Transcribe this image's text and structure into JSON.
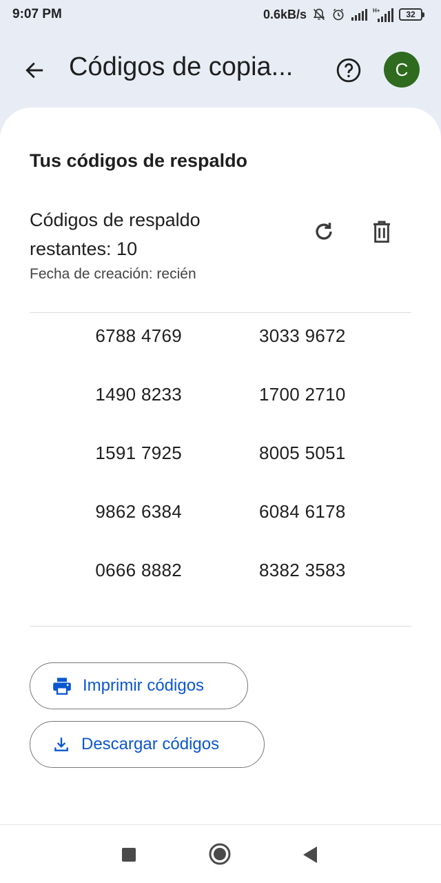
{
  "status_bar": {
    "time": "9:07 PM",
    "speed": "0.6kB/s",
    "icons": [
      "mute-icon",
      "alarm-icon",
      "signal-icon",
      "signal-icon-2"
    ],
    "battery": "32"
  },
  "app_bar": {
    "back_icon": "arrow-left-icon",
    "title": "Códigos de copia...",
    "help_icon": "help-circle-icon",
    "avatar_letter": "C",
    "avatar_color": "#2e6b1f"
  },
  "content": {
    "section_title": "Tus códigos de respaldo",
    "remaining_text": "Códigos de respaldo restantes: 10",
    "created_text": "Fecha de creación: recién",
    "codes": [
      [
        "6788 4769",
        "3033 9672"
      ],
      [
        "1490 8233",
        "1700 2710"
      ],
      [
        "1591 7925",
        "8005 5051"
      ],
      [
        "9862 6384",
        "6084 6178"
      ],
      [
        "0666 8882",
        "8382 3583"
      ]
    ],
    "print_label": "Imprimir códigos",
    "download_label": "Descargar códigos",
    "accent_color": "#0b57d0"
  },
  "nav_bar": {
    "icons": [
      "recents-square-icon",
      "home-circle-icon",
      "back-triangle-icon"
    ]
  }
}
